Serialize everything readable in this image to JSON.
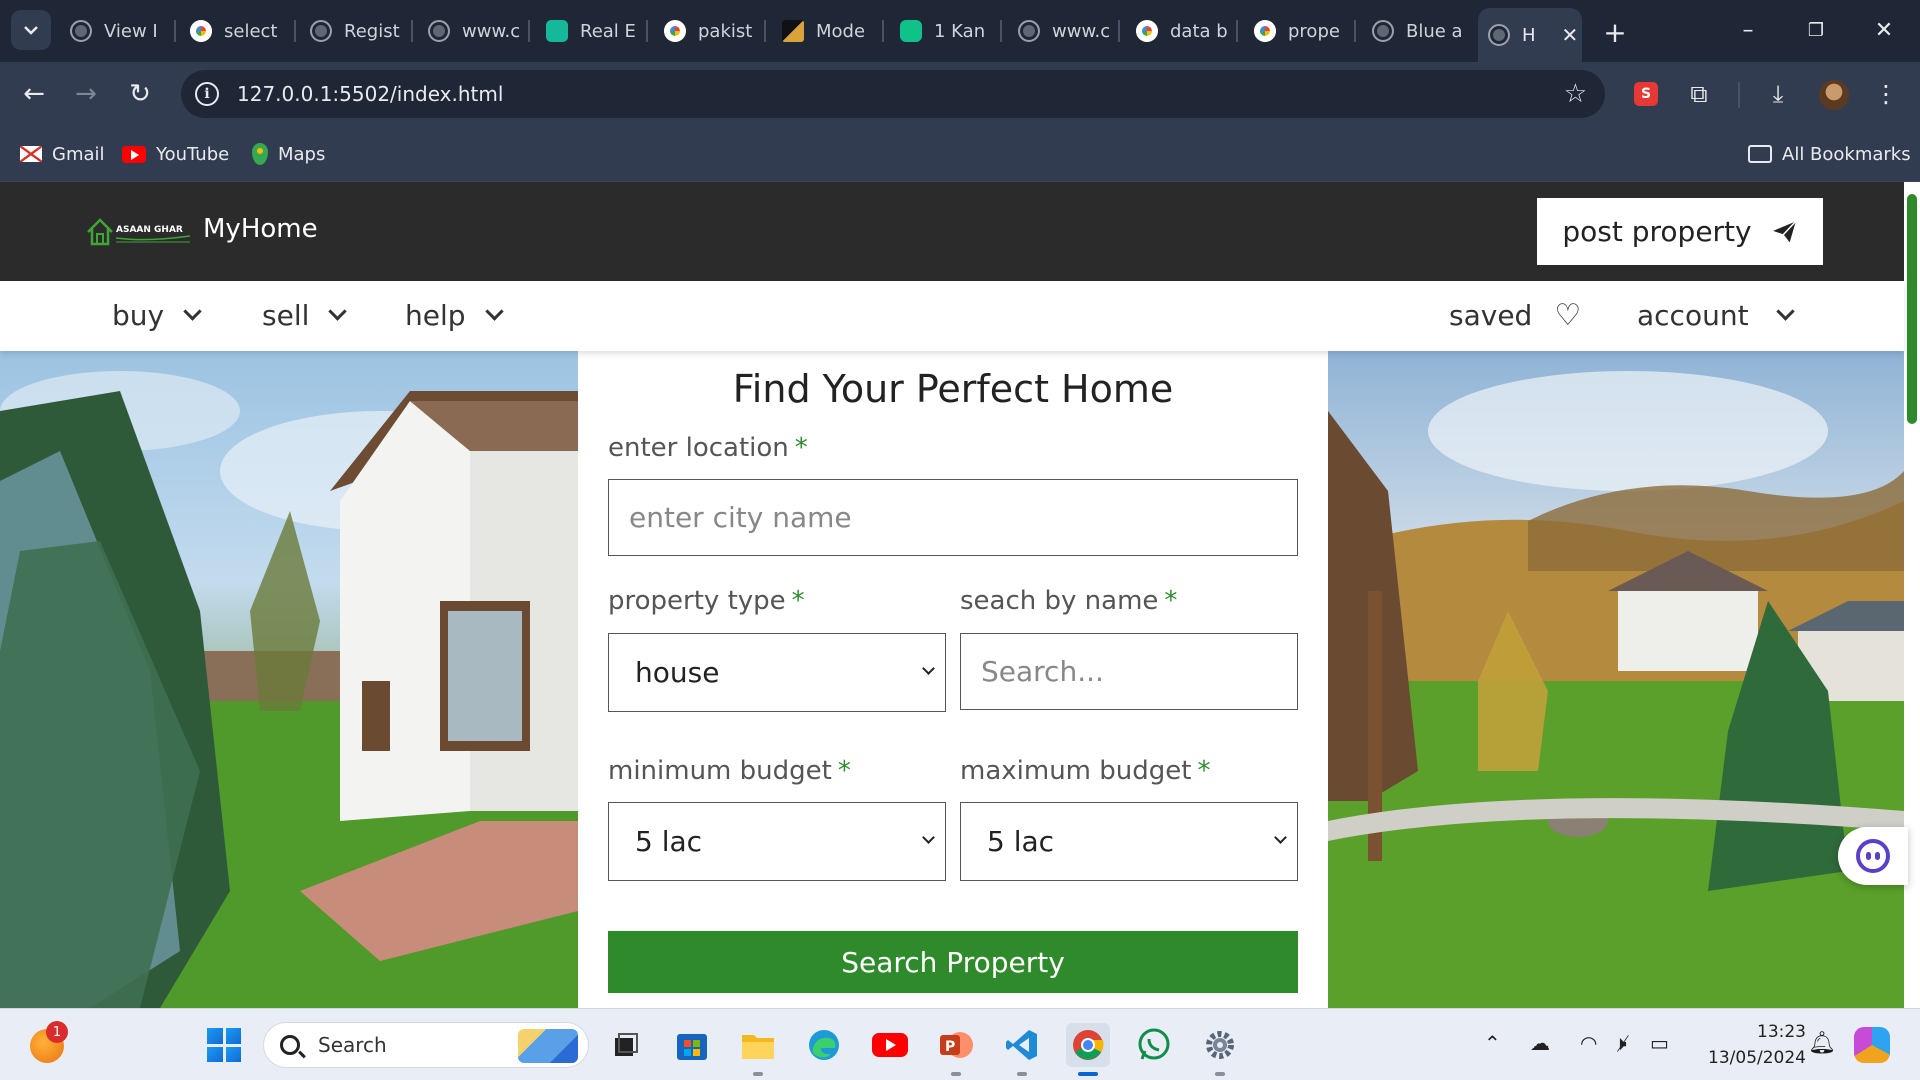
{
  "browser": {
    "tabs": [
      {
        "title": "View I",
        "favicon": "globe-icon"
      },
      {
        "title": "select",
        "favicon": "google-icon"
      },
      {
        "title": "Regist",
        "favicon": "globe-icon"
      },
      {
        "title": "www.c",
        "favicon": "globe-icon"
      },
      {
        "title": "Real E",
        "favicon": "realestate-icon"
      },
      {
        "title": "pakist",
        "favicon": "google-icon"
      },
      {
        "title": "Mode",
        "favicon": "mode-icon"
      },
      {
        "title": "1 Kan",
        "favicon": "zameen-icon"
      },
      {
        "title": "www.c",
        "favicon": "globe-icon"
      },
      {
        "title": "data b",
        "favicon": "google-icon"
      },
      {
        "title": "prope",
        "favicon": "google-icon"
      },
      {
        "title": "Blue a",
        "favicon": "globe-icon"
      },
      {
        "title": "H",
        "favicon": "globe-icon",
        "active": true
      }
    ],
    "url": "127.0.0.1:5502/index.html",
    "bookmarks": [
      {
        "label": "Gmail",
        "icon": "gmail-icon"
      },
      {
        "label": "YouTube",
        "icon": "youtube-icon"
      },
      {
        "label": "Maps",
        "icon": "maps-icon"
      }
    ],
    "all_bookmarks": "All Bookmarks"
  },
  "site": {
    "brand": "MyHome",
    "logo_text": "ASAAN GHAR",
    "post_property": "post property",
    "nav": {
      "buy": "buy",
      "sell": "sell",
      "help": "help",
      "saved": "saved",
      "account": "account"
    },
    "search": {
      "title": "Find Your Perfect Home",
      "location_label": "enter location",
      "location_placeholder": "enter city name",
      "property_type_label": "property type",
      "property_type_value": "house",
      "name_label": "seach by name",
      "name_placeholder": "Search...",
      "min_budget_label": "minimum budget",
      "min_budget_value": "5 lac",
      "max_budget_label": "maximum budget",
      "max_budget_value": "5 lac",
      "required_mark": "*",
      "submit": "Search Property"
    },
    "colors": {
      "header_bg": "#2b2b2b",
      "accent_green": "#2f8a2c"
    }
  },
  "taskbar": {
    "search_label": "Search",
    "notification_count": "1",
    "time": "13:23",
    "date": "13/05/2024"
  }
}
